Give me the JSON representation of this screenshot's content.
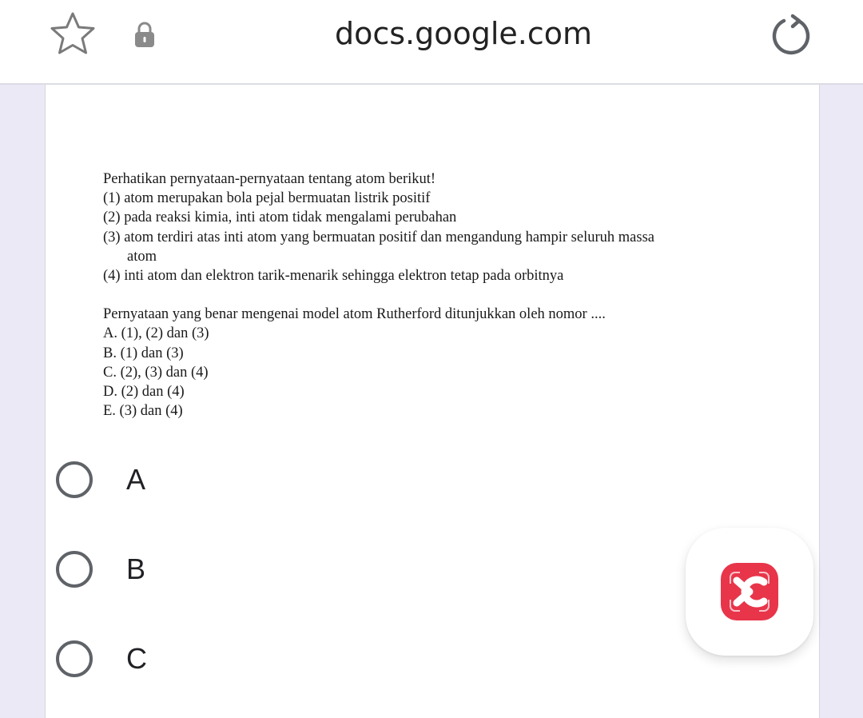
{
  "browser": {
    "url": "docs.google.com",
    "icons": [
      "star-icon",
      "lock-icon",
      "reload-icon"
    ]
  },
  "question": {
    "intro": "Perhatikan pernyataan-pernyataan tentang atom berikut!",
    "statements": [
      "(1) atom merupakan bola pejal bermuatan listrik positif",
      "(2) pada reaksi kimia, inti atom tidak mengalami perubahan",
      "(3) atom terdiri atas inti atom yang bermuatan positif dan mengandung hampir seluruh massa",
      "atom",
      "(4) inti atom dan elektron tarik-menarik sehingga elektron tetap pada orbitnya"
    ],
    "prompt": "Pernyataan yang benar mengenai model atom Rutherford ditunjukkan oleh nomor ....",
    "choices": [
      "A. (1), (2) dan (3)",
      "B. (1) dan (3)",
      "C. (2), (3) dan (4)",
      "D. (2) dan (4)",
      "E. (3) dan (4)"
    ]
  },
  "options": [
    "A",
    "B",
    "C"
  ],
  "floating_button": {
    "icon": "screen-capture-icon",
    "color": "#e8354a"
  },
  "colors": {
    "accent": "#e8354a",
    "radio": "#5f6368",
    "background": "#ece9f7"
  }
}
